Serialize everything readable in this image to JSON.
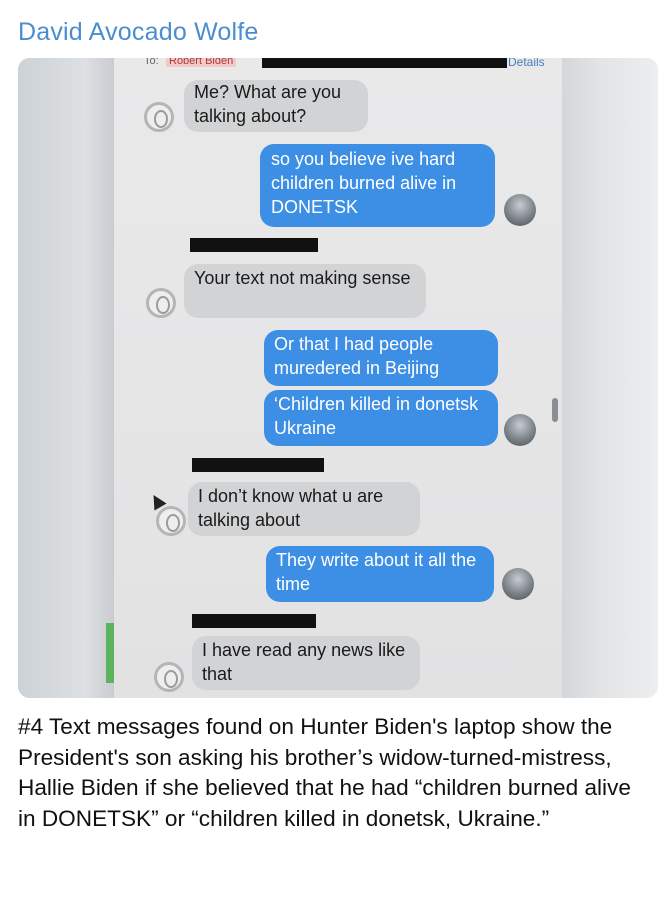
{
  "post": {
    "author": "David Avocado Wolfe",
    "caption": "#4 Text messages found on Hunter Biden's laptop show the President's son asking his brother’s widow-turned-mistress, Hallie Biden if she believed that he had “children burned alive in DONETSK” or “children killed in donetsk, Ukraine.”"
  },
  "screen": {
    "to_label": "To:",
    "recipient": "Robert Biden",
    "details_label": "Details",
    "messages": [
      {
        "from": "them",
        "text": "Me? What are you talking about?"
      },
      {
        "from": "me",
        "text": "so you believe ive hard children burned alive in DONETSK"
      },
      {
        "from": "them",
        "text": "Your text not making sense"
      },
      {
        "from": "me",
        "text": "Or that I had people muredered in Beijing"
      },
      {
        "from": "me",
        "text": "‘Children killed in donetsk Ukraine"
      },
      {
        "from": "them",
        "text": "I don’t know what u are talking about"
      },
      {
        "from": "me",
        "text": "They write about it all the time"
      },
      {
        "from": "them",
        "text": "I have read any news like that"
      }
    ]
  },
  "colors": {
    "author": "#4a8ed0",
    "outgoing_bubble": "#3d8ee5",
    "incoming_bubble": "#d2d3d5"
  }
}
